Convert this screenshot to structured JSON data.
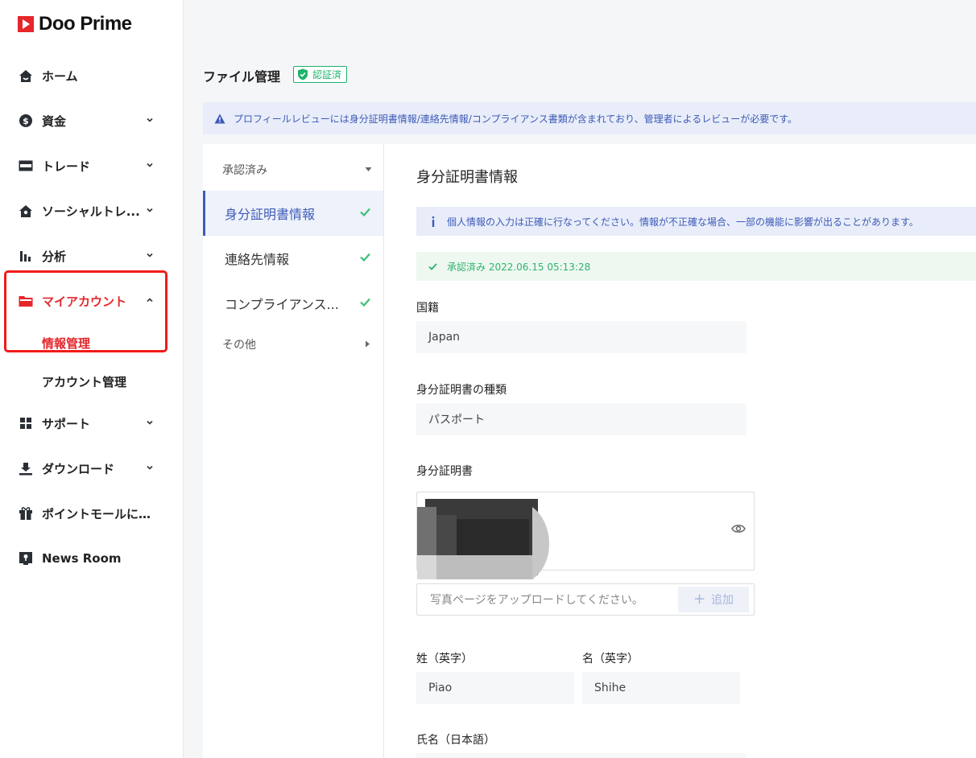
{
  "brand": {
    "name": "Doo Prime"
  },
  "sidebar": {
    "items": [
      {
        "label": "ホーム",
        "icon": "home-icon"
      },
      {
        "label": "資金",
        "icon": "dollar-icon"
      },
      {
        "label": "トレード",
        "icon": "card-icon"
      },
      {
        "label": "ソーシャルトレ...",
        "icon": "social-icon"
      },
      {
        "label": "分析",
        "icon": "bar-chart-icon"
      },
      {
        "label": "マイアカウント",
        "icon": "folder-icon"
      },
      {
        "label": "情報管理"
      },
      {
        "label": "アカウント管理"
      },
      {
        "label": "サポート",
        "icon": "grid-icon"
      },
      {
        "label": "ダウンロード",
        "icon": "download-icon"
      },
      {
        "label": "ポイントモールにロ...",
        "icon": "gift-icon"
      },
      {
        "label": "News Room",
        "icon": "news-room-icon"
      }
    ]
  },
  "page": {
    "title": "ファイル管理",
    "verified_label": "認証済",
    "notice": "プロフィールレビューには身分証明書情報/連絡先情報/コンプライアンス書類が含まれており、管理者によるレビューが必要です。"
  },
  "tabs": {
    "group_approved": "承認済み",
    "items": [
      {
        "label": "身分証明書情報"
      },
      {
        "label": "連絡先情報"
      },
      {
        "label": "コンプライアンス..."
      }
    ],
    "group_other": "その他"
  },
  "content": {
    "title": "身分証明書情報",
    "info": "個人情報の入力は正確に行なってください。情報が不正確な場合、一部の機能に影響が出ることがあります。",
    "approved": "承認済み 2022.06.15 05:13:28",
    "nationality_label": "国籍",
    "nationality_value": "Japan",
    "id_type_label": "身分証明書の種類",
    "id_type_value": "パスポート",
    "id_doc_label": "身分証明書",
    "upload_placeholder": "写真ページをアップロードしてください。",
    "add_label": "追加",
    "last_name_label": "姓（英字）",
    "last_name_value": "Piao",
    "first_name_label": "名（英字）",
    "first_name_value": "Shihe",
    "full_name_jp_label": "氏名（日本語）"
  },
  "colors": {
    "brand_red": "#e5262b",
    "accent_blue": "#3e5ab7",
    "success_green": "#2eb46c",
    "highlight_red": "#f21b1b"
  }
}
